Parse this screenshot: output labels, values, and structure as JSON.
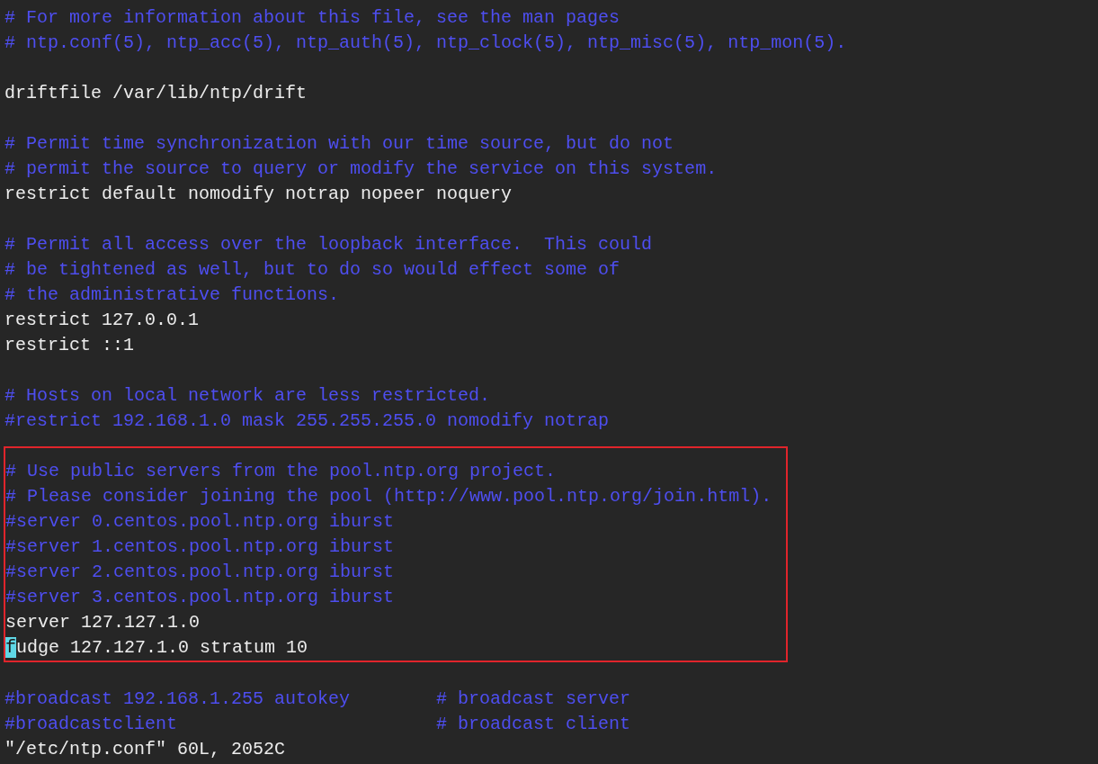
{
  "sections": [
    {
      "highlighted": false,
      "lines": [
        {
          "kind": "comment",
          "text": "# For more information about this file, see the man pages"
        },
        {
          "kind": "comment",
          "text": "# ntp.conf(5), ntp_acc(5), ntp_auth(5), ntp_clock(5), ntp_misc(5), ntp_mon(5)."
        },
        {
          "kind": "blank"
        },
        {
          "kind": "code",
          "text": "driftfile /var/lib/ntp/drift"
        },
        {
          "kind": "blank"
        },
        {
          "kind": "comment",
          "text": "# Permit time synchronization with our time source, but do not"
        },
        {
          "kind": "comment",
          "text": "# permit the source to query or modify the service on this system."
        },
        {
          "kind": "code",
          "text": "restrict default nomodify notrap nopeer noquery"
        },
        {
          "kind": "blank"
        },
        {
          "kind": "comment",
          "text": "# Permit all access over the loopback interface.  This could"
        },
        {
          "kind": "comment",
          "text": "# be tightened as well, but to do so would effect some of"
        },
        {
          "kind": "comment",
          "text": "# the administrative functions."
        },
        {
          "kind": "code",
          "text": "restrict 127.0.0.1"
        },
        {
          "kind": "code",
          "text": "restrict ::1"
        },
        {
          "kind": "blank"
        },
        {
          "kind": "comment",
          "text": "# Hosts on local network are less restricted."
        },
        {
          "kind": "comment",
          "text": "#restrict 192.168.1.0 mask 255.255.255.0 nomodify notrap"
        },
        {
          "kind": "blank"
        }
      ]
    },
    {
      "highlighted": true,
      "lines": [
        {
          "kind": "comment",
          "text": "# Use public servers from the pool.ntp.org project."
        },
        {
          "kind": "comment",
          "text": "# Please consider joining the pool (http://www.pool.ntp.org/join.html)."
        },
        {
          "kind": "comment",
          "text": "#server 0.centos.pool.ntp.org iburst"
        },
        {
          "kind": "comment",
          "text": "#server 1.centos.pool.ntp.org iburst"
        },
        {
          "kind": "comment",
          "text": "#server 2.centos.pool.ntp.org iburst"
        },
        {
          "kind": "comment",
          "text": "#server 3.centos.pool.ntp.org iburst"
        },
        {
          "kind": "code",
          "text": "server 127.127.1.0"
        },
        {
          "kind": "cursor",
          "cursor_text": "f",
          "text": "udge 127.127.1.0 stratum 10"
        }
      ]
    },
    {
      "highlighted": false,
      "lines": [
        {
          "kind": "blank"
        },
        {
          "kind": "comment",
          "text": "#broadcast 192.168.1.255 autokey        # broadcast server"
        },
        {
          "kind": "comment",
          "text": "#broadcastclient                        # broadcast client"
        }
      ]
    }
  ],
  "status_bar": "\"/etc/ntp.conf\" 60L, 2052C"
}
